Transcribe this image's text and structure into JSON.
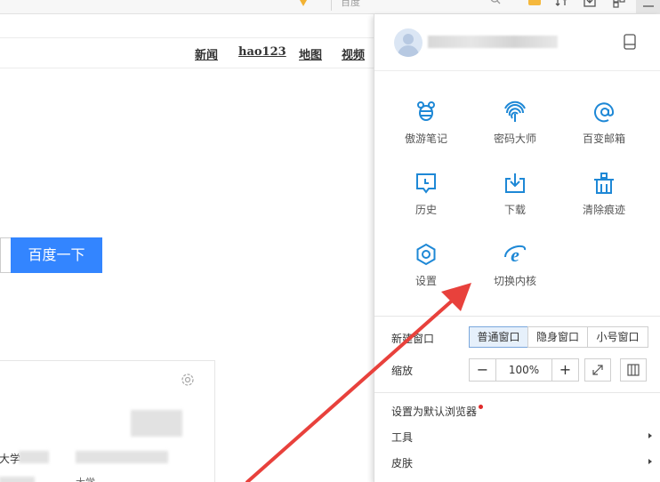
{
  "topbar": {
    "search_placeholder": "百度"
  },
  "page": {
    "nav": [
      "新闻",
      "hao123",
      "地图",
      "视频"
    ],
    "search_button": "百度一下",
    "card_text_1": "大学",
    "card_text_2": "大学…"
  },
  "menu": {
    "tools": [
      {
        "label": "傲游笔记",
        "icon": "bee-icon"
      },
      {
        "label": "密码大师",
        "icon": "fingerprint-icon"
      },
      {
        "label": "百变邮箱",
        "icon": "at-mail-icon"
      },
      {
        "label": "历史",
        "icon": "history-icon"
      },
      {
        "label": "下载",
        "icon": "download-icon"
      },
      {
        "label": "清除痕迹",
        "icon": "clear-traces-icon"
      },
      {
        "label": "设置",
        "icon": "settings-icon"
      },
      {
        "label": "切换内核",
        "icon": "ie-core-icon"
      }
    ],
    "new_window_label": "新建窗口",
    "window_modes": [
      "普通窗口",
      "隐身窗口",
      "小号窗口"
    ],
    "active_mode": "普通窗口",
    "zoom_label": "缩放",
    "zoom_minus": "−",
    "zoom_value": "100%",
    "zoom_plus": "+",
    "set_default": "设置为默认浏览器",
    "tools_item": "工具",
    "skin_item": "皮肤"
  },
  "colors": {
    "accent": "#1e88d6",
    "search_button_bg": "#3385ff",
    "arrow": "#e8413c",
    "active_segment_bg": "#e6f0fb"
  }
}
